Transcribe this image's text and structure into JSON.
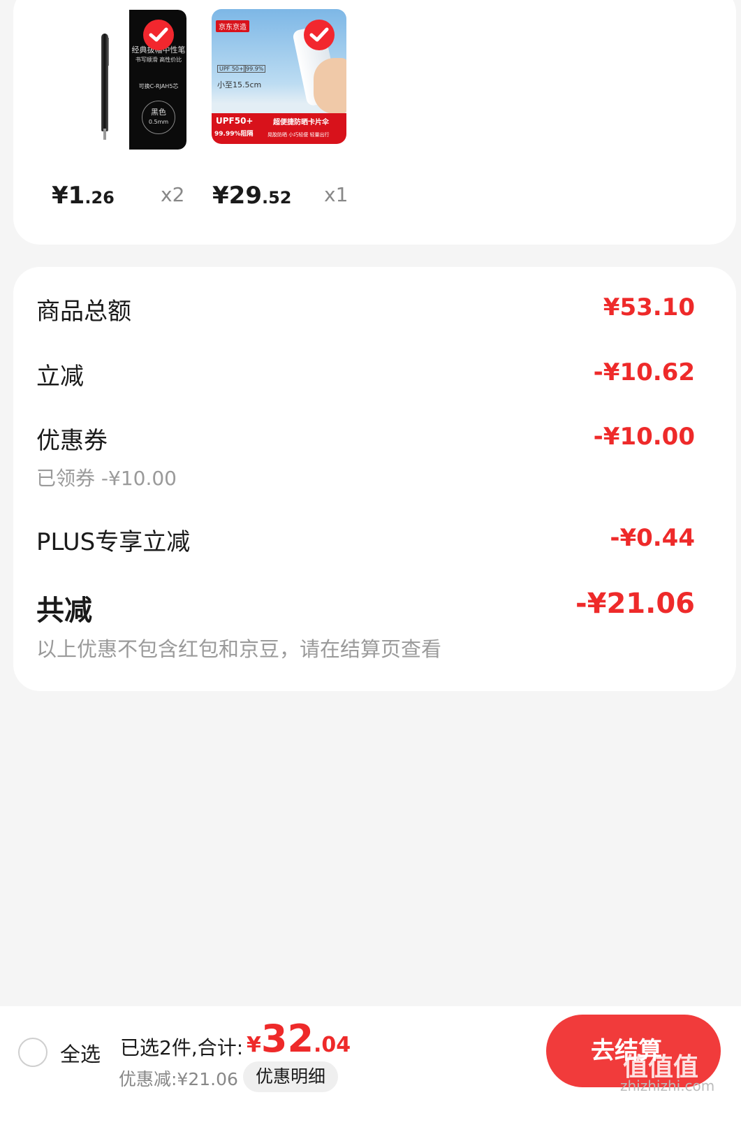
{
  "products": [
    {
      "price_int": "¥1",
      "price_dec": ".26",
      "qty": "x2",
      "thumb_text": [
        "经典拔帽中性笔",
        "书写顺滑 高性价比",
        "可换C-RJAH5芯",
        "黑色",
        "0.5mm"
      ]
    },
    {
      "price_int": "¥29",
      "price_dec": ".52",
      "qty": "x1",
      "thumb_text": [
        "京东京造",
        "UPF 50+",
        "99.9%",
        "小至15.5cm",
        "UPF50+",
        "99.99%阻隔",
        "超便捷防晒卡片伞",
        "晃胶防晒 小巧轻便 轻量出行"
      ]
    }
  ],
  "summary": {
    "rows": [
      {
        "label": "商品总额",
        "value": "¥53.10"
      },
      {
        "label": "立减",
        "value": "-¥10.62"
      },
      {
        "label": "优惠券",
        "value": "-¥10.00",
        "sub": "已领券 -¥10.00"
      },
      {
        "label": "PLUS专享立减",
        "value": "-¥0.44"
      }
    ],
    "total_label": "共减",
    "total_value": "-¥21.06",
    "note": "以上优惠不包含红包和京豆，请在结算页查看"
  },
  "bottom_bar": {
    "select_all": "全选",
    "selected_text": "已选2件,合计:",
    "total_currency": "¥",
    "total_int": "32",
    "total_dec": ".04",
    "discount_text": "优惠减:¥21.06",
    "detail_button": "优惠明细",
    "checkout_button": "去结算"
  },
  "watermark": {
    "logo": "值值值",
    "url": "zhizhizhi.com"
  },
  "colors": {
    "accent": "#ee2a2a",
    "checkout": "#f13b3b",
    "background": "#f5f5f5"
  }
}
